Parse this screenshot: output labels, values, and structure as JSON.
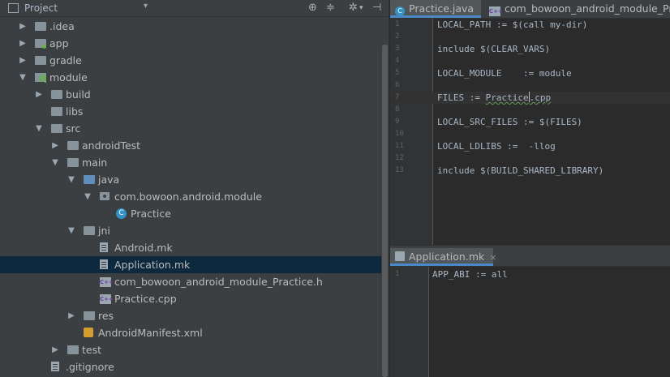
{
  "project_panel": {
    "title": "Project",
    "tree": [
      {
        "label": ".idea",
        "depth": 0,
        "arrow": "▶",
        "icon": "folder-icon"
      },
      {
        "label": "app",
        "depth": 0,
        "arrow": "▶",
        "icon": "folder-icon"
      },
      {
        "label": "gradle",
        "depth": 0,
        "arrow": "▶",
        "icon": "folder-icon"
      },
      {
        "label": "module",
        "depth": 0,
        "arrow": "▼",
        "icon": "module-folder-icon"
      },
      {
        "label": "build",
        "depth": 1,
        "arrow": "▶",
        "icon": "folder-icon"
      },
      {
        "label": "libs",
        "depth": 1,
        "arrow": "",
        "icon": "folder-icon"
      },
      {
        "label": "src",
        "depth": 1,
        "arrow": "▼",
        "icon": "folder-icon"
      },
      {
        "label": "androidTest",
        "depth": 2,
        "arrow": "▶",
        "icon": "folder-icon"
      },
      {
        "label": "main",
        "depth": 2,
        "arrow": "▼",
        "icon": "folder-icon"
      },
      {
        "label": "java",
        "depth": 3,
        "arrow": "▼",
        "icon": "source-folder-icon"
      },
      {
        "label": "com.bowoon.android.module",
        "depth": 4,
        "arrow": "▼",
        "icon": "package-icon"
      },
      {
        "label": "Practice",
        "depth": 5,
        "arrow": "",
        "icon": "java-class-icon"
      },
      {
        "label": "jni",
        "depth": 3,
        "arrow": "▼",
        "icon": "folder-icon"
      },
      {
        "label": "Android.mk",
        "depth": 4,
        "arrow": "",
        "icon": "makefile-icon"
      },
      {
        "label": "Application.mk",
        "depth": 4,
        "arrow": "",
        "icon": "makefile-icon",
        "selected": true
      },
      {
        "label": "com_bowoon_android_module_Practice.h",
        "depth": 4,
        "arrow": "",
        "icon": "cpp-header-icon"
      },
      {
        "label": "Practice.cpp",
        "depth": 4,
        "arrow": "",
        "icon": "cpp-file-icon"
      },
      {
        "label": "res",
        "depth": 3,
        "arrow": "▶",
        "icon": "folder-icon"
      },
      {
        "label": "AndroidManifest.xml",
        "depth": 3,
        "arrow": "",
        "icon": "xml-file-icon"
      },
      {
        "label": "test",
        "depth": 2,
        "arrow": "▶",
        "icon": "folder-icon"
      },
      {
        "label": ".gitignore",
        "depth": 1,
        "arrow": "",
        "icon": "text-file-icon"
      }
    ]
  },
  "editor_top": {
    "tabs": [
      {
        "label": "Practice.java",
        "icon": "C",
        "active": true
      },
      {
        "label": "com_bowoon_android_module_Practic",
        "icon": "C++",
        "active": false
      }
    ],
    "lines": [
      {
        "n": "1",
        "code": "LOCAL_PATH := $(call my-dir)"
      },
      {
        "n": "2",
        "code": ""
      },
      {
        "n": "3",
        "code": "include $(CLEAR_VARS)"
      },
      {
        "n": "4",
        "code": ""
      },
      {
        "n": "5",
        "code": "LOCAL_MODULE    := module"
      },
      {
        "n": "6",
        "code": ""
      },
      {
        "n": "7",
        "code": "FILES := Practice.cpp",
        "current": true
      },
      {
        "n": "8",
        "code": ""
      },
      {
        "n": "9",
        "code": "LOCAL_SRC_FILES := $(FILES)"
      },
      {
        "n": "10",
        "code": ""
      },
      {
        "n": "11",
        "code": "LOCAL_LDLIBS :=  -llog"
      },
      {
        "n": "12",
        "code": ""
      },
      {
        "n": "13",
        "code": "include $(BUILD_SHARED_LIBRARY)"
      }
    ]
  },
  "editor_bottom": {
    "tab": {
      "label": "Application.mk",
      "close": "×"
    },
    "lines": [
      {
        "n": "1",
        "code": "APP_ABI := all"
      }
    ]
  },
  "icons": {
    "dropdown": "▾",
    "locate": "⊕",
    "collapse": "≑",
    "gear": "✲",
    "hide": "⊣"
  }
}
